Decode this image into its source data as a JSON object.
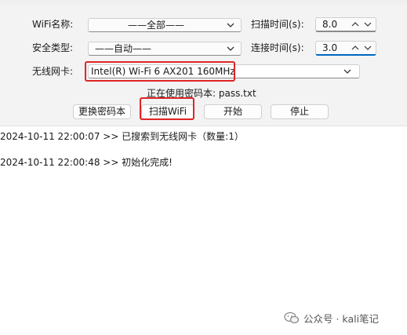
{
  "form": {
    "wifi_name_label": "WiFi名称:",
    "wifi_name_value": "——全部——",
    "security_label": "安全类型:",
    "security_value": "——自动——",
    "adapter_label": "无线网卡:",
    "adapter_value": "Intel(R) Wi-Fi 6 AX201 160MHz",
    "scan_time_label": "扫描时间(s):",
    "scan_time_value": "8.0",
    "connect_time_label": "连接时间(s):",
    "connect_time_value": "3.0",
    "password_file_text": "正在使用密码本: pass.txt"
  },
  "buttons": {
    "change_dict": "更换密码本",
    "scan_wifi": "扫描WiFi",
    "start": "开始",
    "stop": "停止"
  },
  "log": {
    "lines": [
      "2024-10-11 22:00:07 >> 已搜索到无线网卡（数量:1）",
      "2024-10-11 22:00:48 >> 初始化完成!"
    ]
  },
  "watermark": {
    "text": "公众号 · kali笔记"
  },
  "colors": {
    "highlight": "#e02525",
    "focus": "#0067c0"
  }
}
